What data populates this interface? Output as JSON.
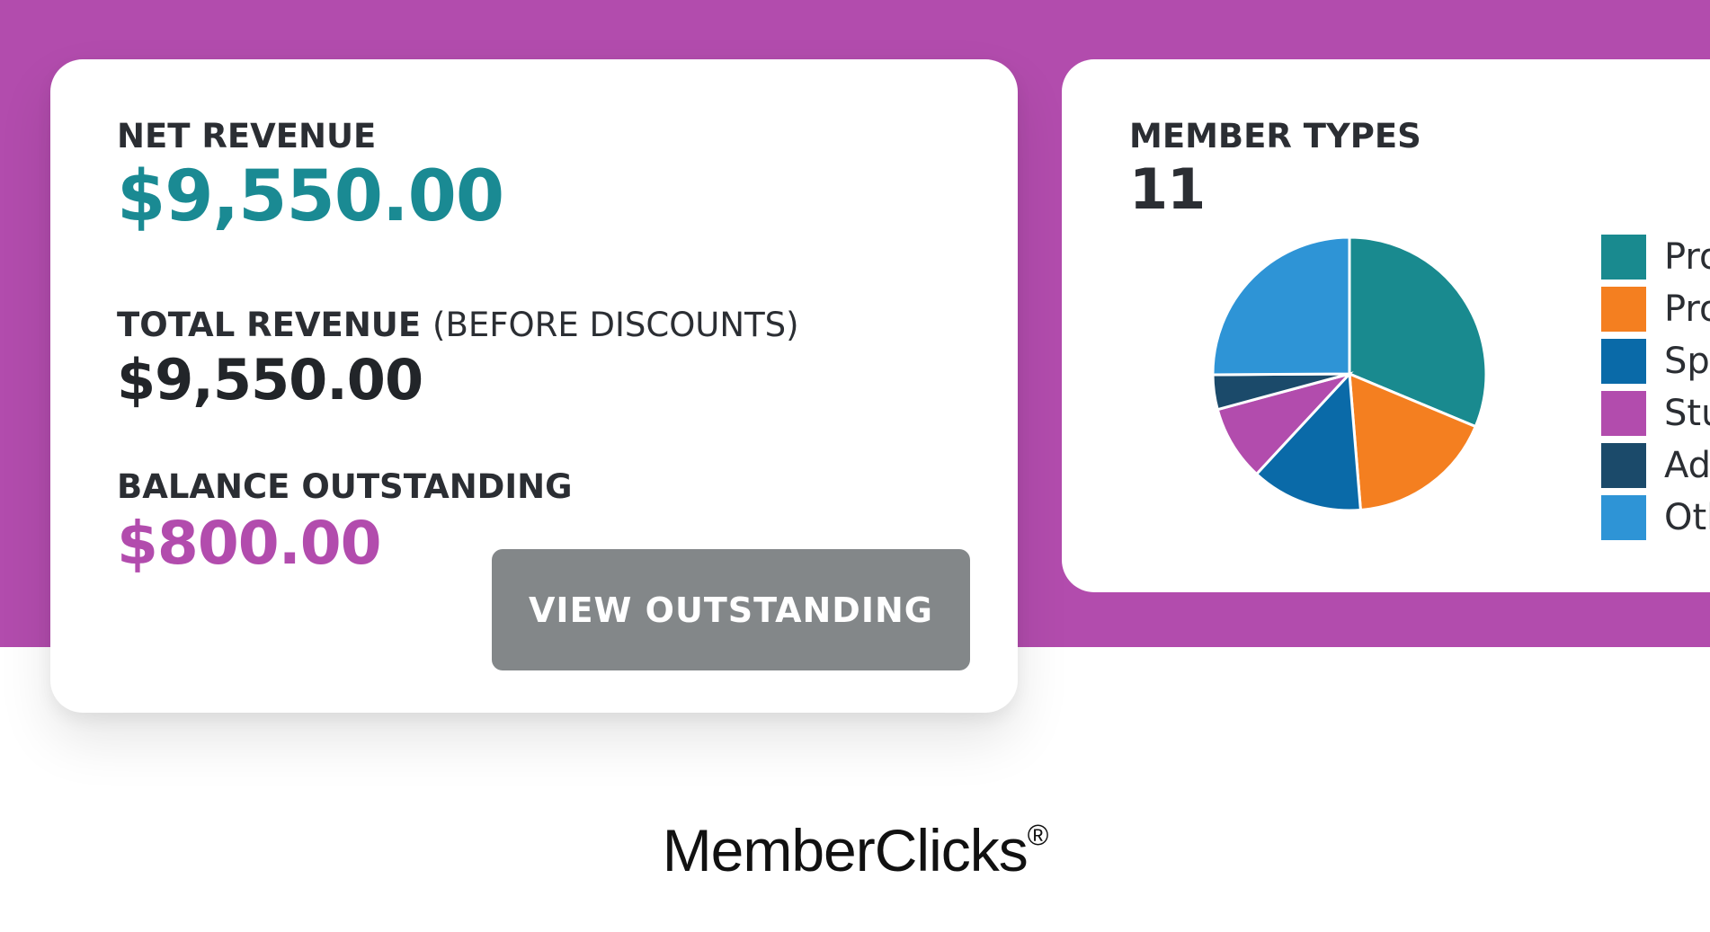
{
  "colors": {
    "band": "#b24cad",
    "net_revenue": "#1a8a93",
    "total_revenue": "#222529",
    "balance": "#b24cad",
    "button_bg": "#838789"
  },
  "revenue_card": {
    "net_revenue": {
      "label": "NET REVENUE",
      "value": "$9,550.00"
    },
    "total_revenue": {
      "label": "TOTAL REVENUE",
      "label_suffix": "(BEFORE DISCOUNTS)",
      "value": "$9,550.00"
    },
    "balance": {
      "label": "BALANCE OUTSTANDING",
      "value": "$800.00"
    },
    "button_label": "VIEW OUTSTANDING"
  },
  "member_card": {
    "title": "MEMBER TYPES",
    "count": "11",
    "legend": [
      {
        "text": "Pro",
        "color": "#198a8f"
      },
      {
        "text": "Pro",
        "color": "#f47f20"
      },
      {
        "text": "Sp",
        "color": "#0a6aa8"
      },
      {
        "text": "Stu",
        "color": "#b24cad"
      },
      {
        "text": "Ad",
        "color": "#1b4a6a"
      },
      {
        "text": "Otl",
        "color": "#2e94d6"
      }
    ]
  },
  "chart_data": {
    "type": "pie",
    "slices": [
      {
        "label": "Pro",
        "value": 0.313,
        "color": "#198a8f"
      },
      {
        "label": "Pro",
        "value": 0.174,
        "color": "#f47f20"
      },
      {
        "label": "Sp",
        "value": 0.132,
        "color": "#0a6aa8"
      },
      {
        "label": "Stu",
        "value": 0.089,
        "color": "#b24cad"
      },
      {
        "label": "Ad",
        "value": 0.041,
        "color": "#1b4a6a"
      },
      {
        "label": "Otl",
        "value": 0.251,
        "color": "#2e94d6"
      }
    ]
  },
  "brand": {
    "name": "MemberClicks",
    "mark": "®"
  }
}
